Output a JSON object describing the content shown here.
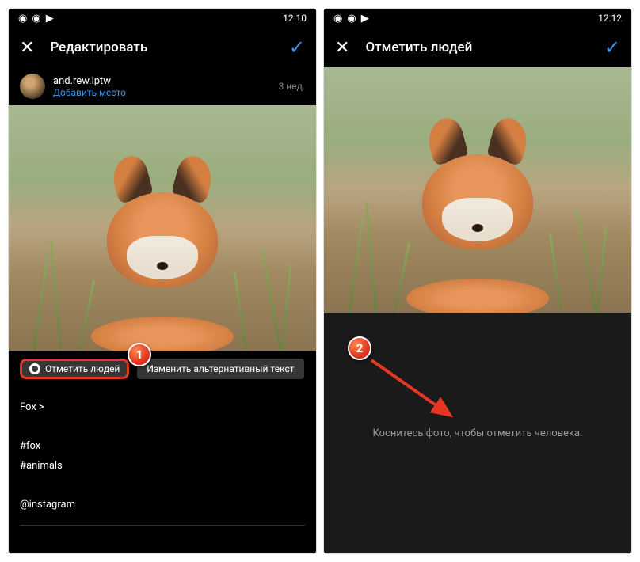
{
  "phone1": {
    "status_time": "12:10",
    "header_title": "Редактировать",
    "username": "and.rew.lptw",
    "add_place": "Добавить место",
    "time_ago": "3 нед.",
    "tag_people": "Отметить людей",
    "alt_text": "Изменить альтернативный текст",
    "caption_fox": "Fox >",
    "caption_hashtag1": "#fox",
    "caption_hashtag2": "#animals",
    "caption_mention": "@instagram",
    "marker_num": "1"
  },
  "phone2": {
    "status_time": "12:12",
    "header_title": "Отметить людей",
    "tap_hint": "Коснитесь фото, чтобы отметить человека.",
    "marker_num": "2"
  },
  "colors": {
    "accent": "#3897f0",
    "highlight": "#e63622"
  }
}
